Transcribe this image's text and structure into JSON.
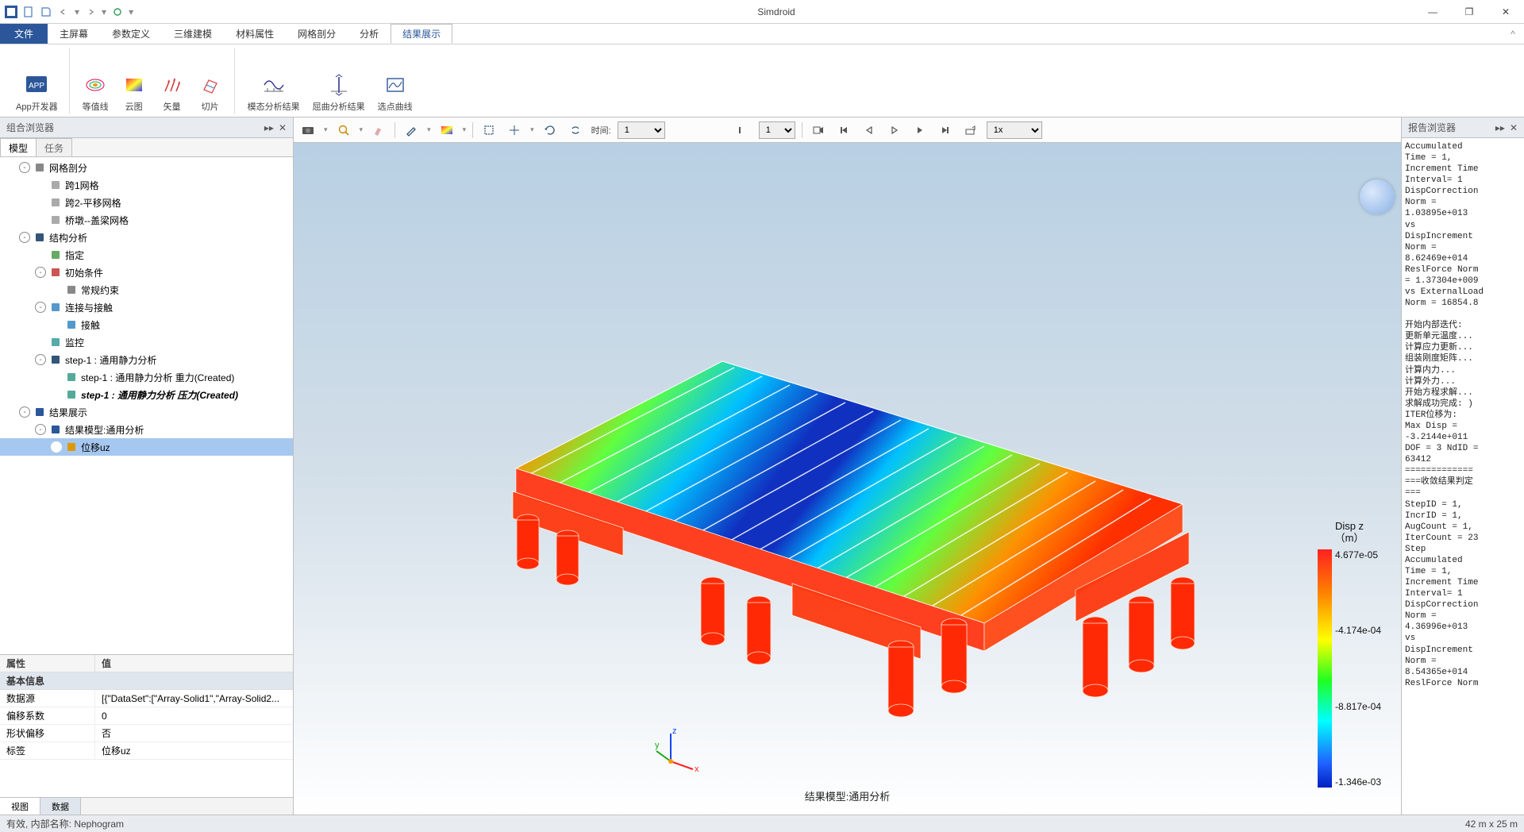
{
  "app": {
    "title": "Simdroid"
  },
  "window": {
    "min": "—",
    "max": "❐",
    "close": "✕"
  },
  "qat": [
    "new",
    "open",
    "save",
    "back",
    "forward",
    "reset"
  ],
  "menu": {
    "file": "文件",
    "tabs": [
      "主屏幕",
      "参数定义",
      "三维建模",
      "材料属性",
      "网格剖分",
      "分析",
      "结果展示"
    ],
    "active": 6
  },
  "ribbon": {
    "app": {
      "label": "App开发器"
    },
    "contour": {
      "label": "等值线"
    },
    "cloud": {
      "label": "云图"
    },
    "vector": {
      "label": "矢量"
    },
    "slice": {
      "label": "切片"
    },
    "modal": {
      "label": "模态分析结果"
    },
    "buckle": {
      "label": "屈曲分析结果"
    },
    "pick": {
      "label": "选点曲线"
    }
  },
  "leftPanel": {
    "title": "组合浏览器",
    "tabs": {
      "model": "模型",
      "task": "任务",
      "active": 0
    }
  },
  "tree": [
    {
      "ind": 1,
      "exp": "-",
      "icon": "mesh",
      "label": "网格剖分"
    },
    {
      "ind": 2,
      "exp": " ",
      "icon": "grid",
      "label": "跨1网格"
    },
    {
      "ind": 2,
      "exp": " ",
      "icon": "grid",
      "label": "跨2-平移网格"
    },
    {
      "ind": 2,
      "exp": " ",
      "icon": "grid",
      "label": "桥墩--盖梁网格"
    },
    {
      "ind": 1,
      "exp": "-",
      "icon": "analysis",
      "label": "结构分析"
    },
    {
      "ind": 2,
      "exp": " ",
      "icon": "assign",
      "label": "指定"
    },
    {
      "ind": 2,
      "exp": "-",
      "icon": "ic",
      "label": "初始条件"
    },
    {
      "ind": 3,
      "exp": " ",
      "icon": "bc",
      "label": "常规约束"
    },
    {
      "ind": 2,
      "exp": "-",
      "icon": "contact",
      "label": "连接与接触"
    },
    {
      "ind": 3,
      "exp": " ",
      "icon": "contact",
      "label": "接触"
    },
    {
      "ind": 2,
      "exp": " ",
      "icon": "monitor",
      "label": "监控"
    },
    {
      "ind": 2,
      "exp": "-",
      "icon": "step",
      "label": "step-1 : 通用静力分析"
    },
    {
      "ind": 3,
      "exp": " ",
      "icon": "load",
      "label": "step-1 : 通用静力分析 重力(Created)"
    },
    {
      "ind": 3,
      "exp": " ",
      "icon": "load",
      "label": "step-1 : 通用静力分析 压力(Created)",
      "bolditalic": true
    },
    {
      "ind": 1,
      "exp": "-",
      "icon": "result",
      "label": "结果展示"
    },
    {
      "ind": 2,
      "exp": "-",
      "icon": "rmodel",
      "label": "结果模型:通用分析"
    },
    {
      "ind": 3,
      "exp": " ",
      "icon": "disp",
      "label": "位移uz",
      "selected": true
    }
  ],
  "props": {
    "head": {
      "name": "属性",
      "value": "值"
    },
    "section": "基本信息",
    "rows": [
      {
        "k": "数据源",
        "v": "[{\"DataSet\":[\"Array-Solid1\",\"Array-Solid2..."
      },
      {
        "k": "偏移系数",
        "v": "0"
      },
      {
        "k": "形状偏移",
        "v": "否"
      },
      {
        "k": "标签",
        "v": "位移uz"
      }
    ]
  },
  "bottomTabs": {
    "view": "视图",
    "data": "数据",
    "active": 1
  },
  "canvasToolbar": {
    "timeLabel": "时间:",
    "timeValue": "1",
    "frameValue": "1",
    "speedValue": "1x"
  },
  "legend": {
    "titleA": "Disp z",
    "titleB": "（m）",
    "ticks": [
      "4.677e-05",
      "-4.174e-04",
      "-8.817e-04",
      "-1.346e-03"
    ]
  },
  "viewportLabel": "结果模型:通用分析",
  "rightPanel": {
    "title": "报告浏览器"
  },
  "report": "Accumulated\nTime = 1,\nIncrement Time\nInterval= 1\nDispCorrection\nNorm =\n1.03895e+013\nvs\nDispIncrement\nNorm =\n8.62469e+014\nReslForce Norm\n= 1.37304e+009\nvs ExternalLoad\nNorm = 16854.8\n\n开始内部迭代:\n更新单元温度...\n计算应力更新...\n组装刚度矩阵...\n计算内力...\n计算外力...\n开始方程求解...\n求解成功完成: )\nITER位移为:\nMax Disp =\n-3.2144e+011\nDOF = 3 NdID =\n63412\n=============\n===收敛结果判定\n===\nStepID = 1,\nIncrID = 1,\nAugCount = 1,\nIterCount = 23\nStep\nAccumulated\nTime = 1,\nIncrement Time\nInterval= 1\nDispCorrection\nNorm =\n4.36996e+013\nvs\nDispIncrement\nNorm =\n8.54365e+014\nReslForce Norm",
  "status": {
    "left": "有效, 内部名称: Nephogram",
    "right": "42 m x 25 m"
  }
}
